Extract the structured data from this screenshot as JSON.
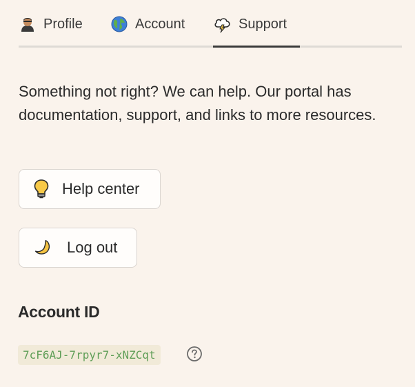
{
  "tabs": [
    {
      "label": "Profile",
      "icon": "person-icon",
      "selected": false
    },
    {
      "label": "Account",
      "icon": "globe-icon",
      "selected": false
    },
    {
      "label": "Support",
      "icon": "lightning-cloud-icon",
      "selected": true
    }
  ],
  "support": {
    "description": "Something not right? We can help. Our portal has documentation, support, and links to more resources.",
    "help_center_label": "Help center",
    "help_center_icon": "lightbulb-icon",
    "logout_label": "Log out",
    "logout_icon": "crescent-moon-icon"
  },
  "account": {
    "heading": "Account ID",
    "id_value": "7cF6AJ-7rpyr7-xNZCqt",
    "help_icon": "question-circle-icon"
  },
  "colors": {
    "background": "#faf3ec",
    "id_text": "#5f9e57",
    "id_background": "#f1ead8",
    "tab_underline_active": "#3a3a3a"
  }
}
